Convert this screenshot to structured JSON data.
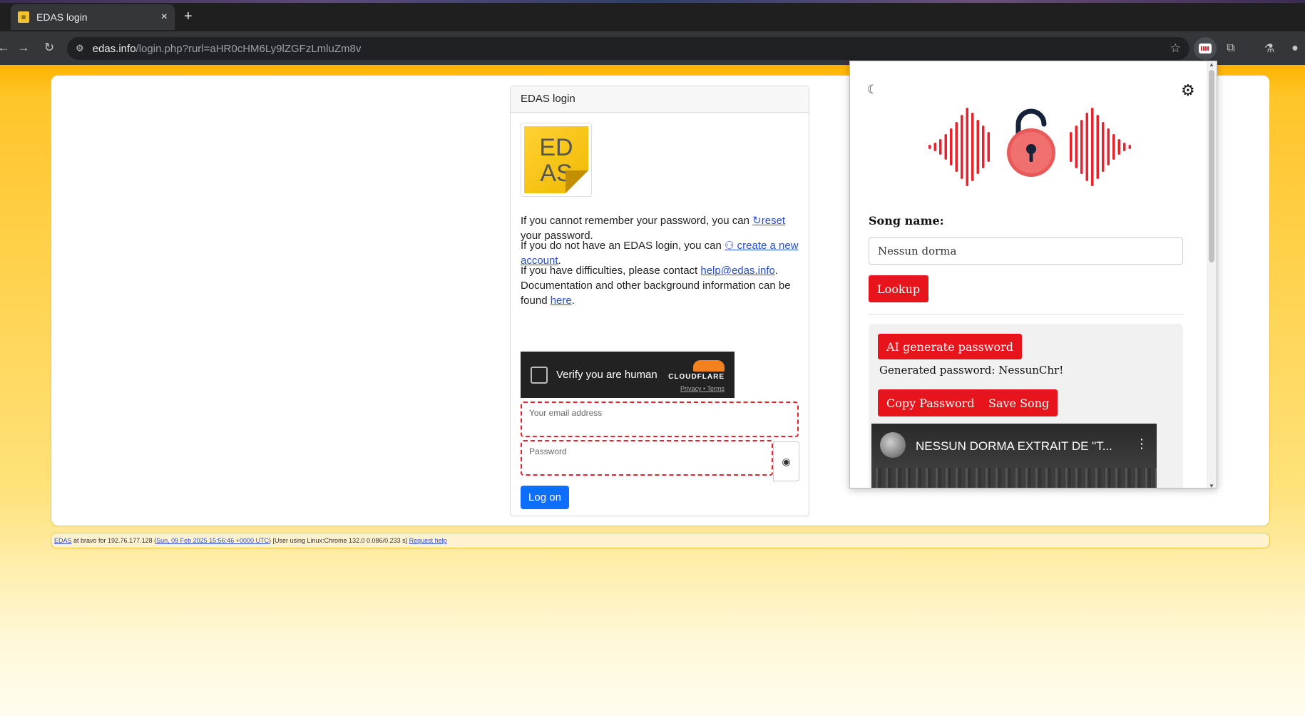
{
  "browser": {
    "tab_title": "EDAS login",
    "tab_close": "×",
    "new_tab": "+",
    "url_host": "edas.info",
    "url_rest": "/login.php?rurl=aHR0cHM6Ly9lZGFzLmluZm8v"
  },
  "login": {
    "card_title": "EDAS login",
    "logo_line1": "ED",
    "logo_line2": "AS",
    "reset_pre": "If you cannot remember your password, you can ",
    "reset_link": "reset",
    "reset_post": " your password.",
    "create_pre": "If you do not have an EDAS login, you can ",
    "create_link": "create a new account",
    "create_post": ".",
    "help_pre": "If you have difficulties, please contact ",
    "help_link": "help@edas.info",
    "help_mid": ". Documentation and other background information can be found ",
    "here_link": "here",
    "help_post": ".",
    "captcha_label": "Verify you are human",
    "captcha_brand": "CLOUDFLARE",
    "captcha_privacy": "Privacy",
    "captcha_terms": "Terms",
    "email_label": "Your email address",
    "password_label": "Password",
    "logon_button": "Log on"
  },
  "footer": {
    "edas_link": "EDAS",
    "text1": " at bravo for 192.76.177.128 (",
    "date_link": "Sun, 09 Feb 2025 15:56:46 +0000 UTC",
    "text2": ") [User using Linux:Chrome 132.0 0.086/0.233 s] ",
    "help_link": "Request help"
  },
  "extension": {
    "song_label": "Song name:",
    "song_value": "Nessun dorma",
    "lookup_button": "Lookup",
    "ai_button": "AI generate password",
    "generated_text": "Generated password: NessunChr!",
    "copy_button": "Copy Password",
    "save_button": "Save Song",
    "video_title": "NESSUN DORMA EXTRAIT DE \"T...",
    "accent_color": "#e8141b"
  }
}
